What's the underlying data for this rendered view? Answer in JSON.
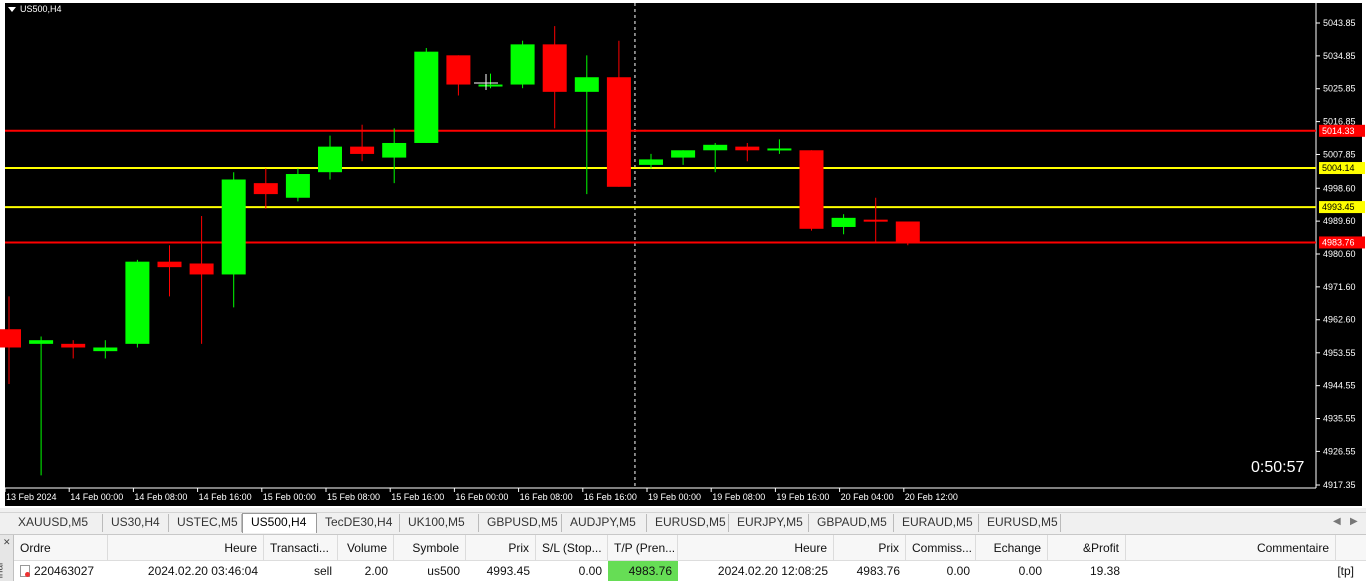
{
  "chart": {
    "symbol_label": "US500,H4",
    "countdown": "0:50:57",
    "colors": {
      "background": "#000000",
      "bull": "#00ff00",
      "bear": "#ff0000",
      "grid_text": "#ffffff",
      "tp_line": "#ff0000",
      "entry_line": "#ffff00"
    },
    "price_axis": {
      "min": 4917.35,
      "max": 5043.85,
      "ticks": [
        "5043.85",
        "5034.85",
        "5025.85",
        "5016.85",
        "5007.85",
        "4998.60",
        "4989.60",
        "4980.60",
        "4971.60",
        "4962.60",
        "4953.55",
        "4944.55",
        "4935.55",
        "4926.55",
        "4917.35"
      ]
    },
    "time_labels": [
      "13 Feb 2024",
      "14 Feb 00:00",
      "14 Feb 08:00",
      "14 Feb 16:00",
      "15 Feb 00:00",
      "15 Feb 08:00",
      "15 Feb 16:00",
      "16 Feb 00:00",
      "16 Feb 08:00",
      "16 Feb 16:00",
      "19 Feb 00:00",
      "19 Feb 08:00",
      "19 Feb 16:00",
      "20 Feb 04:00",
      "20 Feb 12:00"
    ],
    "hlines": [
      {
        "price": 5014.33,
        "label": "5014.33",
        "color": "#ff0000"
      },
      {
        "price": 5004.14,
        "label": "5004.14",
        "color": "#ffff00"
      },
      {
        "price": 4993.45,
        "label": "4993.45",
        "color": "#ffff00"
      },
      {
        "price": 4983.76,
        "label": "4983.76",
        "color": "#ff0000"
      }
    ],
    "crosshair_time_index": 19.5,
    "candles": [
      {
        "o": 4960.0,
        "h": 4969.0,
        "l": 4945.0,
        "c": 4955.0
      },
      {
        "o": 4956.0,
        "h": 4958.0,
        "l": 4920.0,
        "c": 4957.0
      },
      {
        "o": 4956.0,
        "h": 4957.0,
        "l": 4952.0,
        "c": 4955.0
      },
      {
        "o": 4954.0,
        "h": 4957.0,
        "l": 4952.0,
        "c": 4955.0
      },
      {
        "o": 4956.0,
        "h": 4979.0,
        "l": 4955.0,
        "c": 4978.5
      },
      {
        "o": 4978.5,
        "h": 4983.0,
        "l": 4969.0,
        "c": 4977.0
      },
      {
        "o": 4978.0,
        "h": 4991.0,
        "l": 4956.0,
        "c": 4975.0
      },
      {
        "o": 4975.0,
        "h": 5003.0,
        "l": 4966.0,
        "c": 5001.0
      },
      {
        "o": 5000.0,
        "h": 5004.0,
        "l": 4993.0,
        "c": 4997.0
      },
      {
        "o": 4996.0,
        "h": 5004.0,
        "l": 4995.0,
        "c": 5002.5
      },
      {
        "o": 5003.0,
        "h": 5013.0,
        "l": 5001.0,
        "c": 5010.0
      },
      {
        "o": 5010.0,
        "h": 5016.0,
        "l": 5006.0,
        "c": 5008.0
      },
      {
        "o": 5007.0,
        "h": 5015.0,
        "l": 5000.0,
        "c": 5011.0
      },
      {
        "o": 5011.0,
        "h": 5037.0,
        "l": 5011.0,
        "c": 5036.0
      },
      {
        "o": 5035.0,
        "h": 5035.0,
        "l": 5024.0,
        "c": 5027.0
      },
      {
        "o": 5027.0,
        "h": 5030.0,
        "l": 5026.0,
        "c": 5027.0
      },
      {
        "o": 5027.0,
        "h": 5039.0,
        "l": 5026.0,
        "c": 5038.0
      },
      {
        "o": 5038.0,
        "h": 5043.0,
        "l": 5015.0,
        "c": 5025.0
      },
      {
        "o": 5025.0,
        "h": 5035.0,
        "l": 4997.0,
        "c": 5029.0
      },
      {
        "o": 5029.0,
        "h": 5039.0,
        "l": 4999.0,
        "c": 4999.0
      },
      {
        "o": 5005.0,
        "h": 5008.0,
        "l": 5004.0,
        "c": 5006.5
      },
      {
        "o": 5007.0,
        "h": 5009.0,
        "l": 5005.0,
        "c": 5009.0
      },
      {
        "o": 5009.0,
        "h": 5011.0,
        "l": 5003.0,
        "c": 5010.5
      },
      {
        "o": 5010.0,
        "h": 5011.0,
        "l": 5006.0,
        "c": 5009.0
      },
      {
        "o": 5009.5,
        "h": 5012.0,
        "l": 5008.0,
        "c": 5009.5
      },
      {
        "o": 5009.0,
        "h": 5009.0,
        "l": 4987.0,
        "c": 4987.5
      },
      {
        "o": 4988.0,
        "h": 4991.5,
        "l": 4986.0,
        "c": 4990.5
      },
      {
        "o": 4990.0,
        "h": 4996.0,
        "l": 4984.0,
        "c": 4989.5
      },
      {
        "o": 4989.5,
        "h": 4989.5,
        "l": 4983.0,
        "c": 4983.5
      }
    ]
  },
  "tabs": [
    "XAUUSD,M5",
    "US30,H4",
    "USTEC,M5",
    "US500,H4",
    "TecDE30,H4",
    "UK100,M5",
    "GBPUSD,M5",
    "AUDJPY,M5",
    "EURUSD,M5",
    "EURJPY,M5",
    "GBPAUD,M5",
    "EURAUD,M5",
    "EURUSD,M5"
  ],
  "active_tab_index": 3,
  "terminal": {
    "side_label": "inal",
    "columns": [
      "Ordre",
      "Heure",
      "Transacti...",
      "Volume",
      "Symbole",
      "Prix",
      "S/L (Stop...",
      "T/P (Pren...",
      "Heure",
      "Prix",
      "Commiss...",
      "Echange",
      "&Profit",
      "Commentaire"
    ],
    "row": {
      "ordre": "220463027",
      "heure_open": "2024.02.20 03:46:04",
      "type": "sell",
      "volume": "2.00",
      "symbole": "us500",
      "prix_open": "4993.45",
      "sl": "0.00",
      "tp": "4983.76",
      "heure_close": "2024.02.20 12:08:25",
      "prix_close": "4983.76",
      "commission": "0.00",
      "echange": "0.00",
      "profit": "19.38",
      "commentaire": "[tp]"
    }
  }
}
